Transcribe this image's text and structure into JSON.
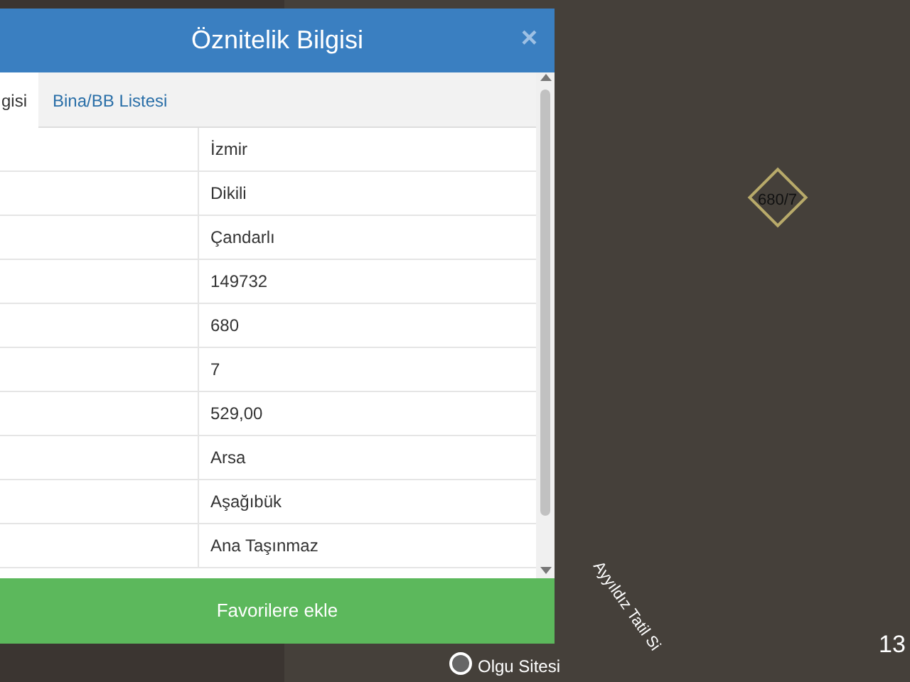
{
  "dialog": {
    "title": "Öznitelik Bilgisi",
    "close": "×",
    "tabs": [
      {
        "label": "gisi",
        "selected": true
      },
      {
        "label": "Bina/BB Listesi",
        "selected": false
      }
    ],
    "rows": [
      "İzmir",
      "Dikili",
      "Çandarlı",
      "149732",
      "680",
      "7",
      "529,00",
      "Arsa",
      "Aşağıbük",
      "Ana Taşınmaz"
    ],
    "footer_button": "Favorilere ekle"
  },
  "map": {
    "parcel_label": "680/7",
    "place_label": "Olgu Sitesi",
    "street_label": "Ayyıldız Tatil Si",
    "edge_label": "13"
  }
}
